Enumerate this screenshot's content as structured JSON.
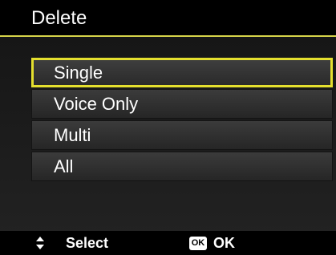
{
  "header": {
    "title": "Delete"
  },
  "menu": {
    "items": [
      {
        "label": "Single",
        "selected": true
      },
      {
        "label": "Voice Only",
        "selected": false
      },
      {
        "label": "Multi",
        "selected": false
      },
      {
        "label": "All",
        "selected": false
      }
    ]
  },
  "footer": {
    "select_label": "Select",
    "ok_icon_text": "OK",
    "ok_label": "OK",
    "updown_icon": "up-down-arrows-icon"
  },
  "colors": {
    "accent": "#e4df2e",
    "background": "#1b1b1b",
    "item_background": "#303030",
    "text": "#ffffff"
  }
}
